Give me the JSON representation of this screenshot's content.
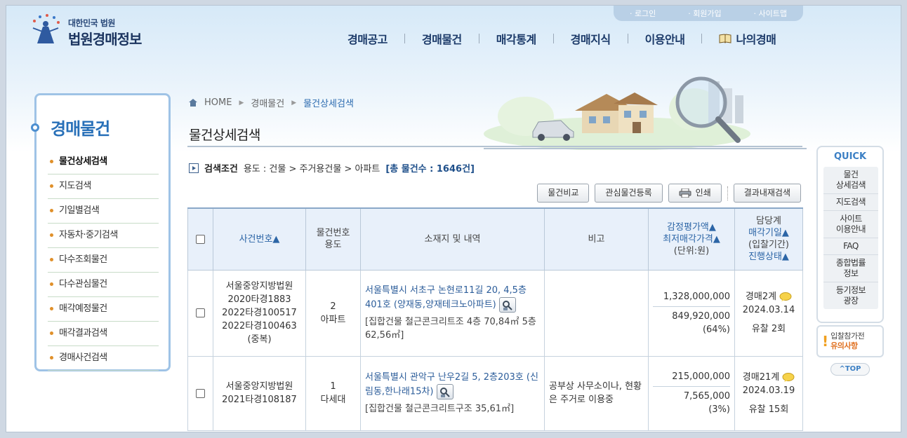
{
  "header": {
    "logo_small": "대한민국 법원",
    "logo_big": "법원경매정보",
    "util": [
      "로그인",
      "회원가입",
      "사이트맵"
    ],
    "gnb": [
      "경매공고",
      "경매물건",
      "매각통계",
      "경매지식",
      "이용안내",
      "나의경매"
    ]
  },
  "sidebar": {
    "title": "경매물건",
    "items": [
      {
        "label": "물건상세검색",
        "active": true
      },
      {
        "label": "지도검색"
      },
      {
        "label": "기일별검색"
      },
      {
        "label": "자동차·중기검색"
      },
      {
        "label": "다수조회물건"
      },
      {
        "label": "다수관심물건"
      },
      {
        "label": "매각예정물건"
      },
      {
        "label": "매각결과검색"
      },
      {
        "label": "경매사건검색"
      }
    ]
  },
  "breadcrumb": [
    "HOME",
    "경매물건",
    "물건상세검색"
  ],
  "page_title": "물건상세검색",
  "conditions": {
    "label": "검색조건",
    "path": "용도 : 건물 > 주거용건물 > 아파트",
    "count": "[총 물건수 : 1646건]"
  },
  "buttons": {
    "compare": "물건비교",
    "interest": "관심물건등록",
    "print": "인쇄",
    "research": "결과내재검색"
  },
  "table": {
    "headers": {
      "case": "사건번호▲",
      "item_no_1": "물건번호",
      "item_no_2": "용도",
      "address": "소재지 및 내역",
      "remark": "비고",
      "price_1": "감정평가액▲",
      "price_2": "최저매각가격▲",
      "price_3": "(단위:원)",
      "dept_1": "담당계",
      "dept_2": "매각기일▲",
      "dept_3": "(입찰기간)",
      "dept_4": "진행상태▲"
    },
    "rows": [
      {
        "court": "서울중앙지방법원",
        "cases": [
          "2020타경1883",
          "2022타경100517",
          "2022타경100463",
          "(중복)"
        ],
        "item_no": "2",
        "usage": "아파트",
        "address": "서울특별시 서초구 논현로11길 20, 4,5층401호 (양재동,양재테크노아파트)",
        "detail": "[집합건물 철근콘크리트조 4층 70,84㎡ 5층 62,56㎡]",
        "remark": "",
        "appraisal": "1,328,000,000",
        "minimum": "849,920,000",
        "ratio": "(64%)",
        "dept": "경매2계",
        "date": "2024.03.14",
        "status": "유찰 2회"
      },
      {
        "court": "서울중앙지방법원",
        "cases": [
          "2021타경108187"
        ],
        "item_no": "1",
        "usage": "다세대",
        "address": "서울특별시 관악구 난우2길 5, 2층203호 (신림동,한나래15차)",
        "detail": "[집합건물 철근콘크리트구조 35,61㎡]",
        "remark": "공부상 사무소이나, 현황은 주거로 이용중",
        "appraisal": "215,000,000",
        "minimum": "7,565,000",
        "ratio": "(3%)",
        "dept": "경매21계",
        "date": "2024.03.19",
        "status": "유찰 15회"
      }
    ]
  },
  "quick": {
    "title": "QUICK",
    "items": [
      [
        "물건",
        "상세검색"
      ],
      [
        "지도검색"
      ],
      [
        "사이트",
        "이용안내"
      ],
      [
        "FAQ"
      ],
      [
        "종합법률",
        "정보"
      ],
      [
        "등기정보",
        "광장"
      ]
    ],
    "warn_1": "입찰참가전",
    "warn_2": "유의사항",
    "top": "^TOP"
  }
}
